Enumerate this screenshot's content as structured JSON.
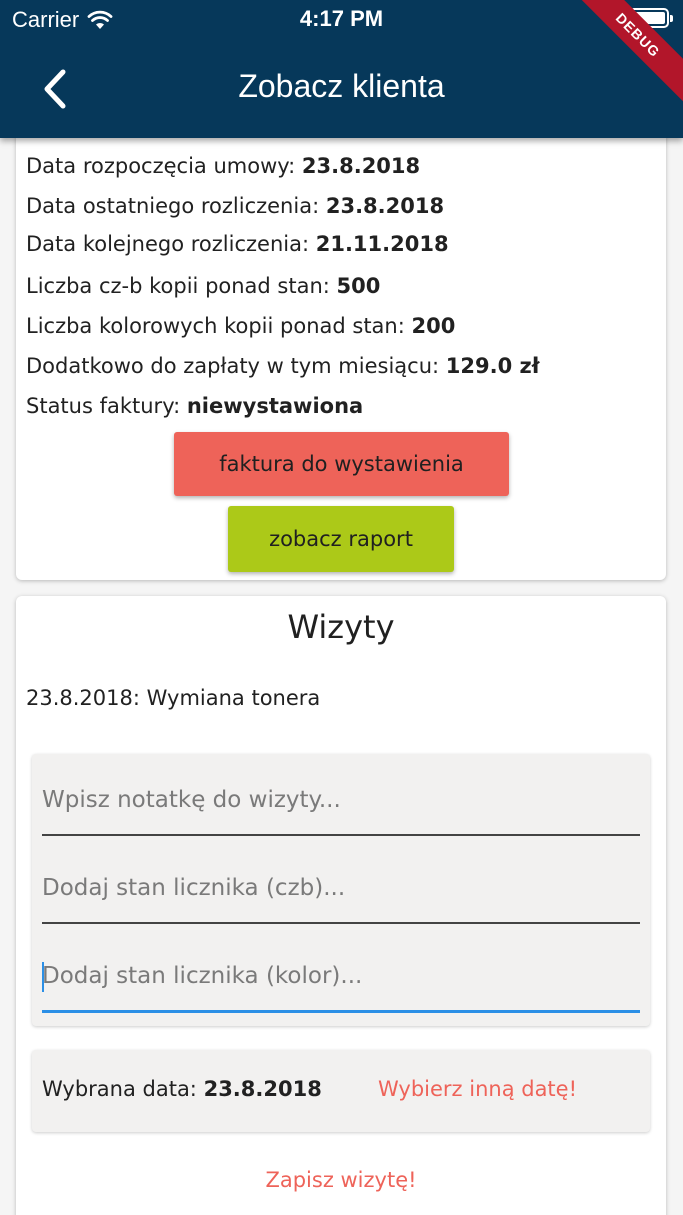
{
  "status_bar": {
    "carrier": "Carrier",
    "time": "4:17 PM"
  },
  "app_bar": {
    "title": "Zobacz klienta",
    "debug_banner": "DEBUG"
  },
  "details": {
    "contract_start": {
      "label": "Data rozpoczęcia umowy:",
      "value": "23.8.2018"
    },
    "last_settlement": {
      "label": "Data ostatniego rozliczenia:",
      "value": "23.8.2018"
    },
    "next_settlement": {
      "label": "Data kolejnego rozliczenia:",
      "value": "21.11.2018"
    },
    "bw_copies": {
      "label": "Liczba cz-b kopii ponad stan:",
      "value": "500"
    },
    "color_copies": {
      "label": "Liczba kolorowych kopii ponad stan:",
      "value": "200"
    },
    "extra_payment": {
      "label": "Dodatkowo do zapłaty w tym miesiącu:",
      "value": "129.0 zł"
    },
    "invoice_status": {
      "label": "Status faktury:",
      "value": "niewystawiona"
    },
    "invoice_button": "faktura do wystawienia",
    "report_button": "zobacz raport"
  },
  "visits": {
    "title": "Wizyty",
    "entries": [
      "23.8.2018: Wymiana tonera"
    ],
    "note_placeholder": "Wpisz notatkę do wizyty...",
    "czb_placeholder": "Dodaj stan licznika (czb)...",
    "kolor_placeholder": "Dodaj stan licznika (kolor)...",
    "selected_date_label": "Wybrana data:",
    "selected_date_value": "23.8.2018",
    "choose_date_link": "Wybierz inną datę!",
    "save_button": "Zapisz wizytę!"
  },
  "colors": {
    "app_bar": "#06385a",
    "invoice_button": "#ee6359",
    "report_button": "#acc918",
    "accent_link": "#ee6359",
    "focus_underline": "#2b8fe6",
    "debug_banner": "#b2162a"
  }
}
